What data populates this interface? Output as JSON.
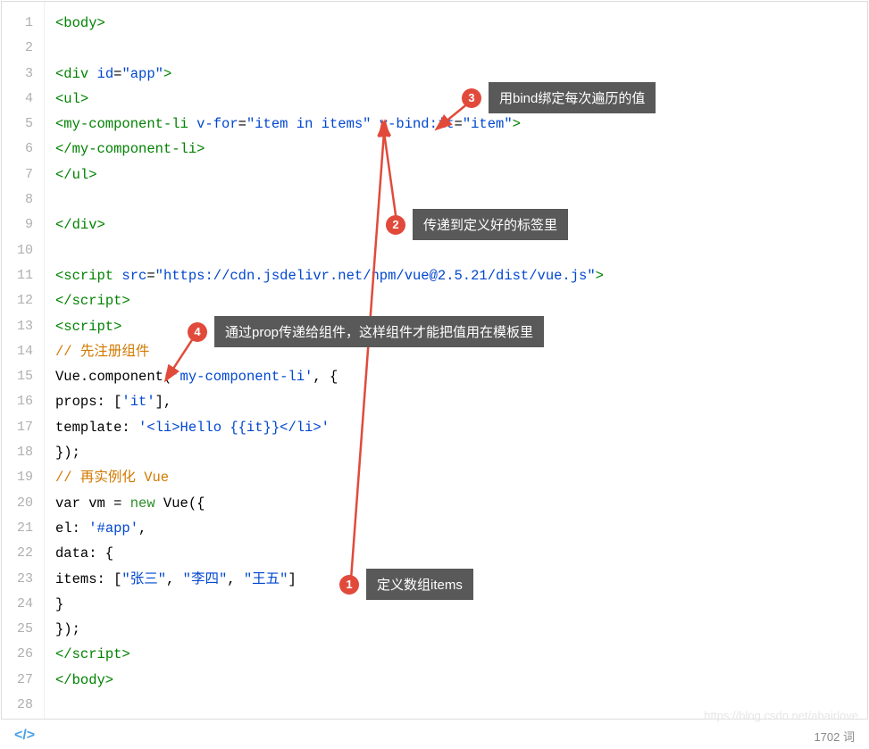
{
  "lines": [
    "1",
    "2",
    "3",
    "4",
    "5",
    "6",
    "7",
    "8",
    "9",
    "10",
    "11",
    "12",
    "13",
    "14",
    "15",
    "16",
    "17",
    "18",
    "19",
    "20",
    "21",
    "22",
    "23",
    "24",
    "25",
    "26",
    "27",
    "28"
  ],
  "code": {
    "l1": {
      "tag_open": "<body>"
    },
    "l2": "",
    "l3": {
      "o": "<div",
      "a": " id",
      "eq": "=",
      "v": "\"app\"",
      "c": ">"
    },
    "l4": {
      "tag_open": "<ul>"
    },
    "l5": {
      "o": "<my-component-li",
      "a1": " v-for",
      "eq1": "=",
      "v1": "\"item in items\"",
      "a2": " v-bind:it",
      "eq2": "=",
      "v2": "\"item\"",
      "c": ">"
    },
    "l6": {
      "tag_close": "</my-component-li>"
    },
    "l7": {
      "tag_close": "</ul>"
    },
    "l8": "",
    "l9": {
      "tag_close": "</div>"
    },
    "l10": "",
    "l11": {
      "o": "<script",
      "a": " src",
      "eq": "=",
      "v": "\"https://cdn.jsdelivr.net/npm/vue@2.5.21/dist/vue.js\"",
      "c": ">"
    },
    "l12": {
      "tag_close": "</scr"
    },
    "l12b": "ipt>",
    "l13": {
      "tag_open": "<script>"
    },
    "l14": {
      "comment": "// 先注册组件"
    },
    "l15": {
      "p1": "Vue.component(",
      "s1": "'my-component-li'",
      "p2": ", {"
    },
    "l16": {
      "p1": "props: [",
      "s1": "'it'",
      "p2": "],"
    },
    "l17": {
      "p1": "template: ",
      "s1": "'<li>Hello {{it}}</li>'"
    },
    "l18": {
      "p1": "});"
    },
    "l19": {
      "comment": "// 再实例化 Vue"
    },
    "l20": {
      "p1": "var vm = ",
      "kw": "new",
      "p2": " Vue({"
    },
    "l21": {
      "p1": "el: ",
      "s1": "'#app'",
      "p2": ","
    },
    "l22": {
      "p1": "data: {"
    },
    "l23": {
      "p1": "items: [",
      "s1": "\"张三\"",
      "c1": ", ",
      "s2": "\"李四\"",
      "c2": ", ",
      "s3": "\"王五\"",
      "p2": "]"
    },
    "l24": {
      "p1": "}"
    },
    "l25": {
      "p1": "});"
    },
    "l26": {
      "tag_close": "</scr",
      "b": "ipt>"
    },
    "l27": {
      "tag_close": "</body>"
    },
    "l28": ""
  },
  "annotations": {
    "a1": {
      "num": "1",
      "text": "定义数组items"
    },
    "a2": {
      "num": "2",
      "text": "传递到定义好的标签里"
    },
    "a3": {
      "num": "3",
      "text": "用bind绑定每次遍历的值"
    },
    "a4": {
      "num": "4",
      "text": "通过prop传递给组件，这样组件才能把值用在模板里"
    }
  },
  "footer": {
    "word_count": "1702 词"
  },
  "watermark": "https://blog.csdn.net/abairlove"
}
